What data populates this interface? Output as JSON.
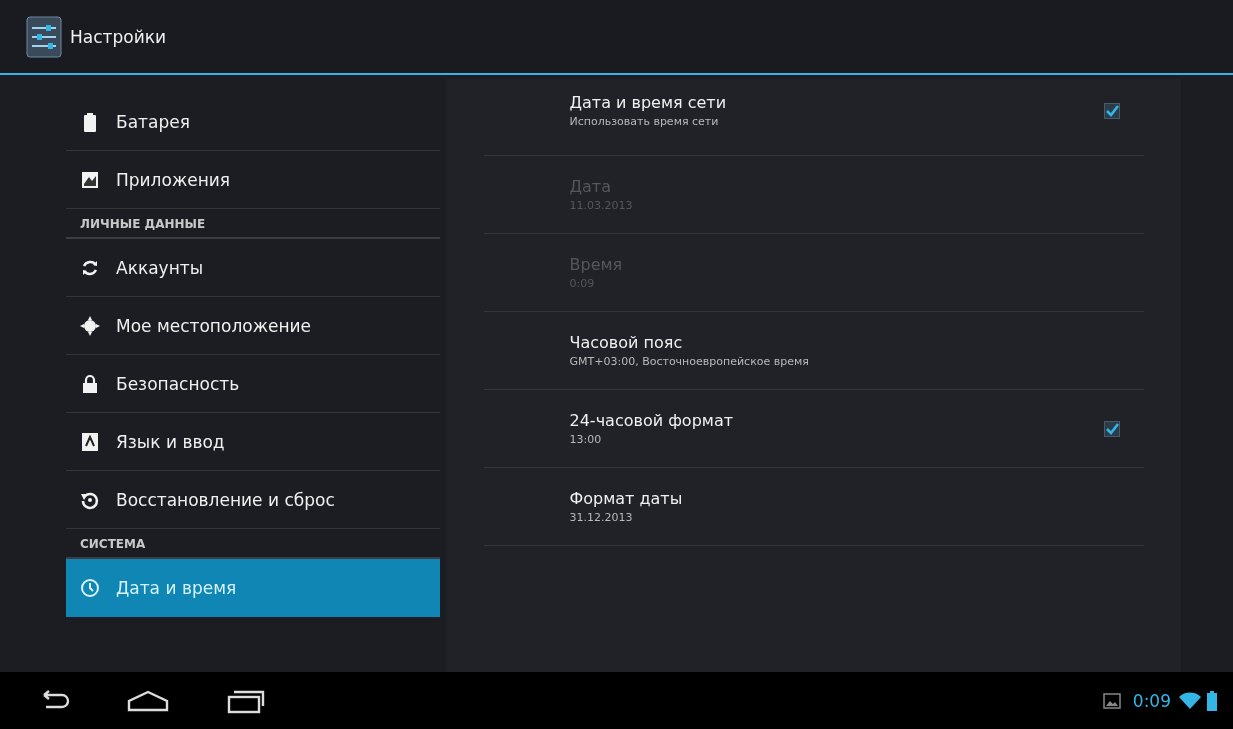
{
  "action_bar": {
    "title": "Настройки"
  },
  "sidebar": [
    {
      "kind": "item",
      "label": "Батарея",
      "selected": false
    },
    {
      "kind": "item",
      "label": "Приложения",
      "selected": false
    },
    {
      "kind": "header",
      "label": "ЛИЧНЫЕ ДАННЫЕ"
    },
    {
      "kind": "item",
      "label": "Аккаунты",
      "selected": false
    },
    {
      "kind": "item",
      "label": "Мое местоположение",
      "selected": false
    },
    {
      "kind": "item",
      "label": "Безопасность",
      "selected": false
    },
    {
      "kind": "item",
      "label": "Язык и ввод",
      "selected": false
    },
    {
      "kind": "item",
      "label": "Восстановление и сброс",
      "selected": false
    },
    {
      "kind": "header",
      "label": "СИСТЕМА"
    },
    {
      "kind": "item",
      "label": "Дата и время",
      "selected": true
    }
  ],
  "settings": [
    {
      "kind": "check",
      "title": "Дата и время сети",
      "summary": "Использовать время сети",
      "disabled": false,
      "checked": true
    },
    {
      "kind": "plain",
      "title": "Дата",
      "summary": "11.03.2013",
      "disabled": true
    },
    {
      "kind": "plain",
      "title": "Время",
      "summary": "0:09",
      "disabled": true
    },
    {
      "kind": "plain",
      "title": "Часовой пояс",
      "summary": "GMT+03:00, Восточноевропейское время",
      "disabled": false
    },
    {
      "kind": "check",
      "title": "24-часовой формат",
      "summary": "13:00",
      "disabled": false,
      "checked": true
    },
    {
      "kind": "plain",
      "title": "Формат даты",
      "summary": "31.12.2013",
      "disabled": false
    }
  ],
  "status_bar": {
    "time": "0:09"
  }
}
